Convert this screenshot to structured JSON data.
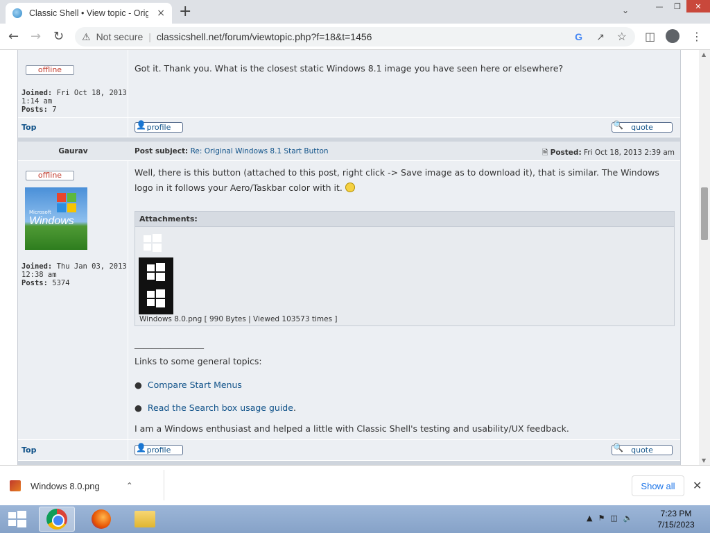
{
  "browser": {
    "tab_title": "Classic Shell • View topic - Origin",
    "tab_close": "×",
    "new_tab": "+",
    "security_label": "Not secure",
    "url": "classicshell.net/forum/viewtopic.php?f=18&t=1456"
  },
  "post1": {
    "status": "offline",
    "joined_label": "Joined:",
    "joined_value": "Fri Oct 18, 2013 1:14 am",
    "posts_label": "Posts:",
    "posts_value": "7",
    "message": "Got it. Thank you. What is the closest static Windows 8.1 image you have seen here or elsewhere?",
    "top_link": "Top",
    "profile_label": "profile",
    "quote_label": "quote"
  },
  "post2": {
    "author": "Gaurav",
    "subject_label": "Post subject:",
    "subject": "Re: Original Windows 8.1 Start Button",
    "posted_label": "Posted:",
    "posted_value": "Fri Oct 18, 2013 2:39 am",
    "status": "offline",
    "avatar_text_small": "Microsoft",
    "avatar_text": "Windows",
    "joined_label": "Joined:",
    "joined_value": "Thu Jan 03, 2013 12:38 am",
    "posts_label": "Posts:",
    "posts_value": "5374",
    "message": "Well, there is this button (attached to this post, right click -> Save image as to download it), that is similar. The Windows logo in it follows your Aero/Taskbar color with it.",
    "attachments_label": "Attachments:",
    "attachment_caption": "Windows 8.0.png [ 990 Bytes | Viewed 103573 times ]",
    "signature_rule": "________________",
    "links_intro": "Links to some general topics:",
    "link1": "Compare Start Menus",
    "link2": "Read the Search box usage guide",
    "link2_suffix": ".",
    "signature_text": "I am a Windows enthusiast and helped a little with Classic Shell's testing and usability/UX feedback.",
    "top_link": "Top",
    "profile_label": "profile",
    "quote_label": "quote"
  },
  "download_shelf": {
    "filename": "Windows 8.0.png",
    "show_all": "Show all"
  },
  "taskbar": {
    "time": "7:23 PM",
    "date": "7/15/2023"
  },
  "colors": {
    "link": "#105289",
    "offline": "#c0392b",
    "post_bg": "#eceff3"
  }
}
